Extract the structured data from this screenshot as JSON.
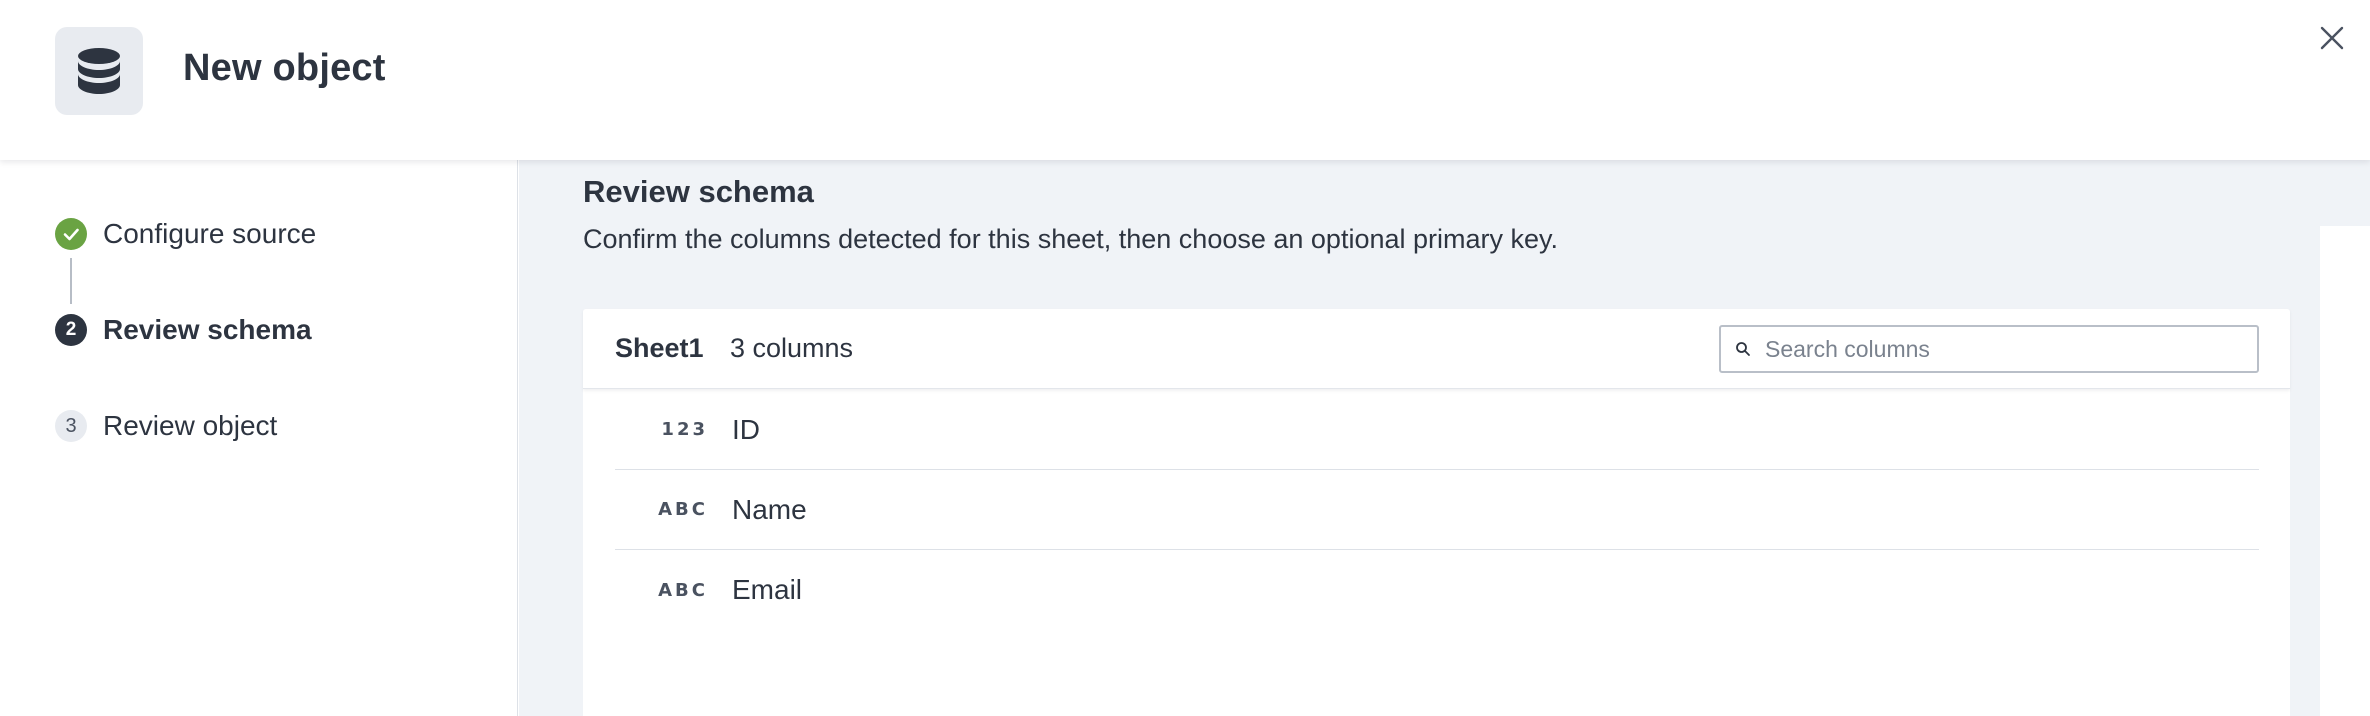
{
  "header": {
    "title": "New object",
    "icon": "database-icon"
  },
  "steps": [
    {
      "marker": "",
      "label": "Configure source",
      "status": "complete"
    },
    {
      "marker": "2",
      "label": "Review schema",
      "status": "active"
    },
    {
      "marker": "3",
      "label": "Review object",
      "status": "pending"
    }
  ],
  "main": {
    "title": "Review schema",
    "description": "Confirm the columns detected for this sheet, then choose an optional primary key.",
    "sheet": {
      "name": "Sheet1",
      "count": "3 columns",
      "search_placeholder": "Search columns",
      "columns": [
        {
          "type": "123",
          "name": "ID"
        },
        {
          "type": "ABC",
          "name": "Name"
        },
        {
          "type": "ABC",
          "name": "Email"
        }
      ]
    }
  },
  "colors": {
    "complete": "#6aa343",
    "active": "#2d3440",
    "main_bg": "#f0f3f7"
  }
}
